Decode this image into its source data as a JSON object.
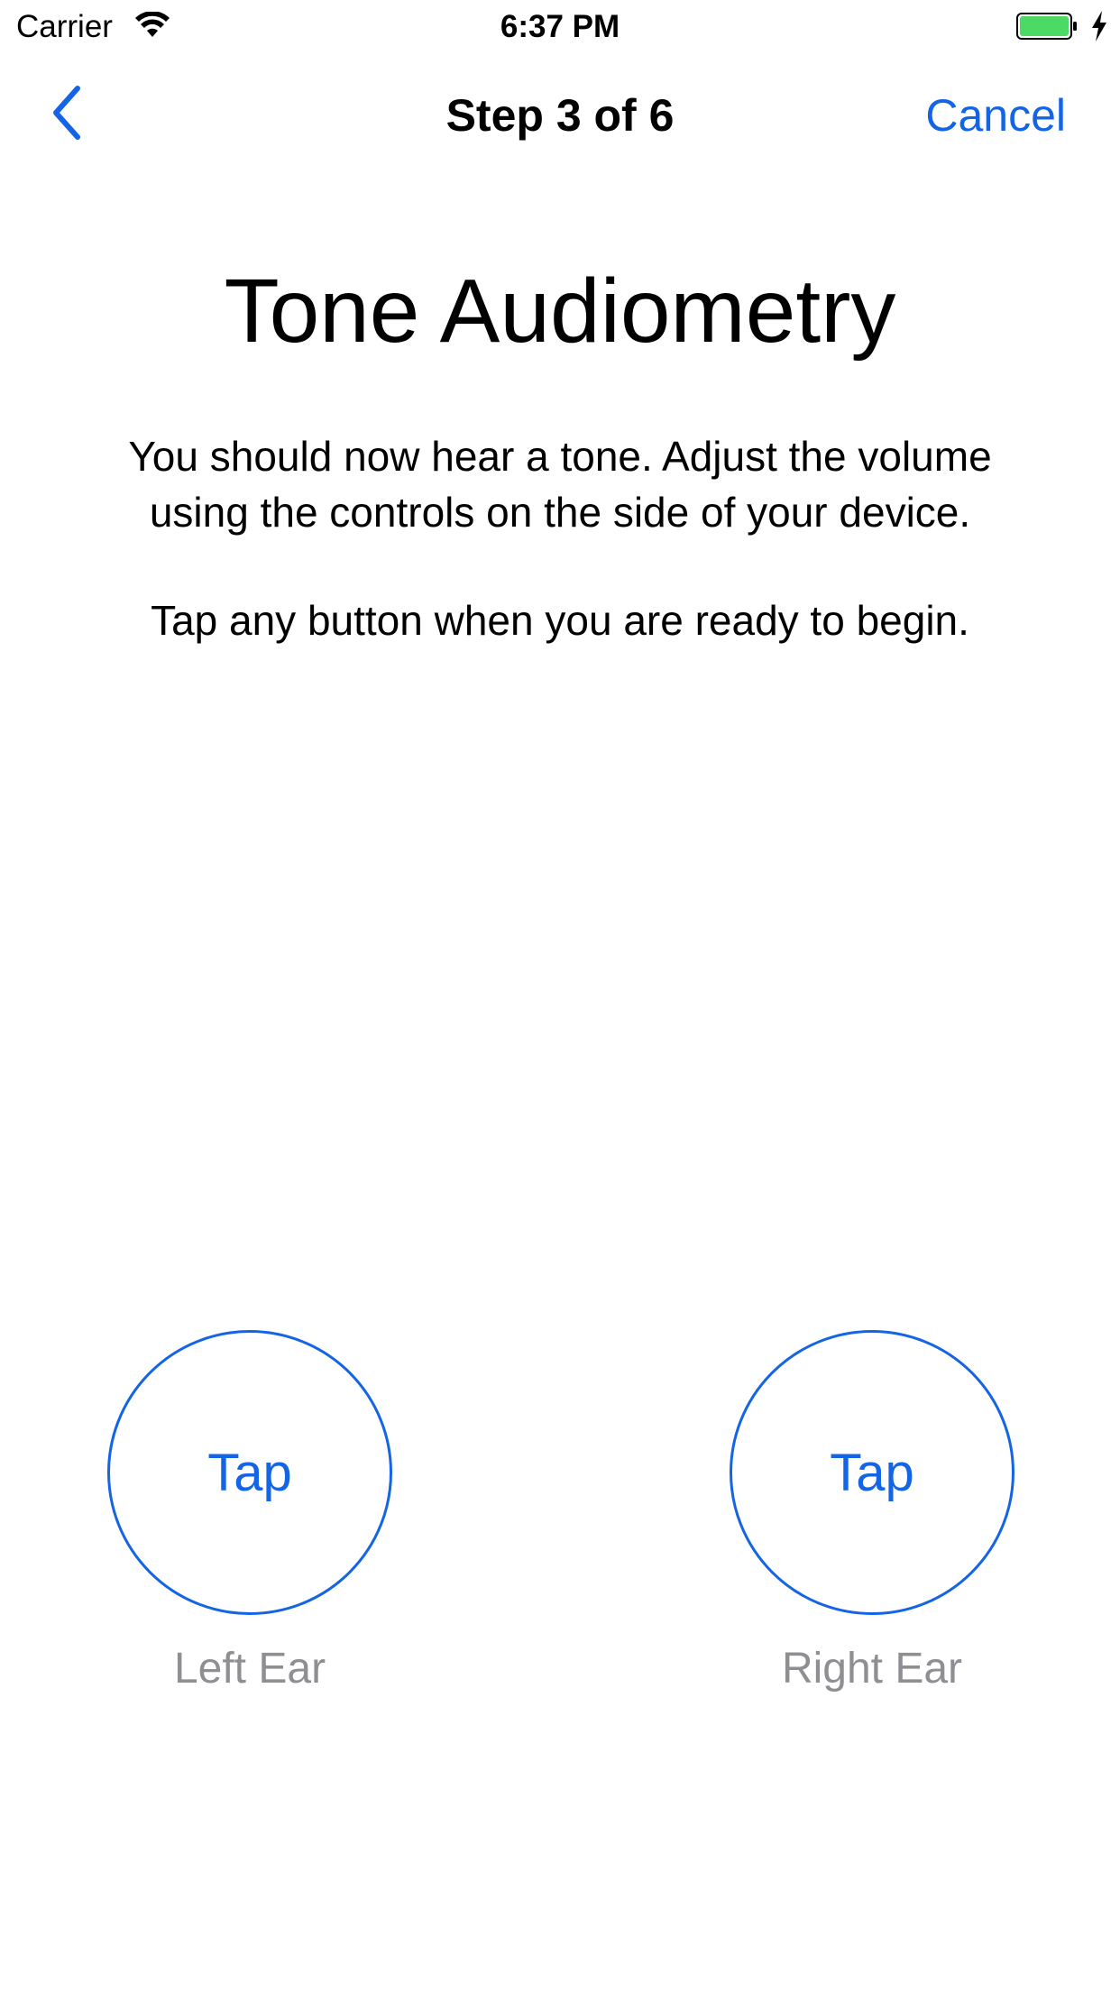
{
  "status_bar": {
    "carrier": "Carrier",
    "time": "6:37 PM",
    "battery_color": "#4cd964",
    "icons": [
      "wifi-icon",
      "battery-icon",
      "charging-bolt-icon"
    ]
  },
  "nav": {
    "title": "Step 3 of 6",
    "back_icon": "chevron-left-icon",
    "cancel_label": "Cancel",
    "tint_color": "#1464e6"
  },
  "content": {
    "headline": "Tone Audiometry",
    "instructions_line1": "You should now hear a tone. Adjust the volume",
    "instructions_line2": "using the controls on the side of your device.",
    "prompt": "Tap any button when you are ready to begin."
  },
  "buttons": {
    "left": {
      "label": "Tap",
      "caption": "Left Ear"
    },
    "right": {
      "label": "Tap",
      "caption": "Right Ear"
    }
  }
}
